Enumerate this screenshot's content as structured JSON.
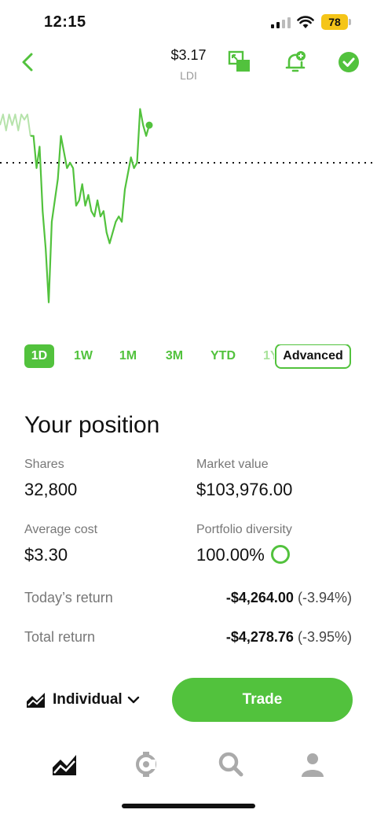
{
  "status": {
    "time": "12:15",
    "battery": "78"
  },
  "header": {
    "price": "$3.17",
    "ticker": "LDI",
    "icons": [
      "back-chevron-icon",
      "fullscreen-chart-icon",
      "add-alert-bell-icon",
      "checkmark-circle-icon"
    ]
  },
  "chart_data": {
    "type": "line",
    "x": [
      "1",
      "2",
      "3",
      "4",
      "5",
      "6",
      "7",
      "8",
      "9",
      "10",
      "11",
      "12",
      "13",
      "14",
      "15",
      "16",
      "17",
      "18",
      "19",
      "20",
      "21",
      "22",
      "23",
      "24",
      "25",
      "26",
      "27",
      "28",
      "29",
      "30",
      "31",
      "32",
      "33",
      "34",
      "35",
      "36",
      "37",
      "38",
      "39",
      "40",
      "41",
      "42",
      "43",
      "44",
      "45",
      "46",
      "47",
      "48",
      "49",
      "50"
    ],
    "series": [
      {
        "values": [
          3.28,
          3.3,
          3.27,
          3.3,
          3.28,
          3.3,
          3.27,
          3.3,
          3.29,
          3.3,
          3.26,
          3.26,
          3.2,
          3.24,
          3.12,
          3.05,
          2.95,
          3.1,
          3.14,
          3.18,
          3.26,
          3.23,
          3.2,
          3.21,
          3.2,
          3.13,
          3.14,
          3.17,
          3.13,
          3.15,
          3.12,
          3.11,
          3.14,
          3.11,
          3.12,
          3.08,
          3.06,
          3.08,
          3.1,
          3.11,
          3.1,
          3.16,
          3.19,
          3.22,
          3.2,
          3.21,
          3.31,
          3.28,
          3.26,
          3.28
        ],
        "color": "#52c23d"
      }
    ],
    "reference_line": 3.21,
    "ylim": [
      2.92,
      3.33
    ],
    "grid": false,
    "annotation": "dotted previous-close line"
  },
  "ranges": {
    "tabs": [
      "1D",
      "1W",
      "1M",
      "3M",
      "YTD",
      "1Y"
    ],
    "active": "1D",
    "advanced_label": "Advanced"
  },
  "position": {
    "title": "Your position",
    "shares_label": "Shares",
    "shares_value": "32,800",
    "market_value_label": "Market value",
    "market_value": "$103,976.00",
    "avg_cost_label": "Average cost",
    "avg_cost_value": "$3.30",
    "diversity_label": "Portfolio diversity",
    "diversity_value": "100.00%",
    "today_return_label": "Today’s return",
    "today_return_amount": "-$4,264.00",
    "today_return_pct": "(-3.94%)",
    "total_return_label": "Total return",
    "total_return_amount": "-$4,278.76",
    "total_return_pct": "(-3.95%)"
  },
  "footer": {
    "account_label": "Individual",
    "trade_label": "Trade"
  },
  "tabbar": {
    "items": [
      "investing-chart-icon",
      "crypto-icon",
      "search-icon",
      "account-person-icon"
    ]
  },
  "colors": {
    "accent": "#52c23d",
    "battery": "#f5c518"
  }
}
